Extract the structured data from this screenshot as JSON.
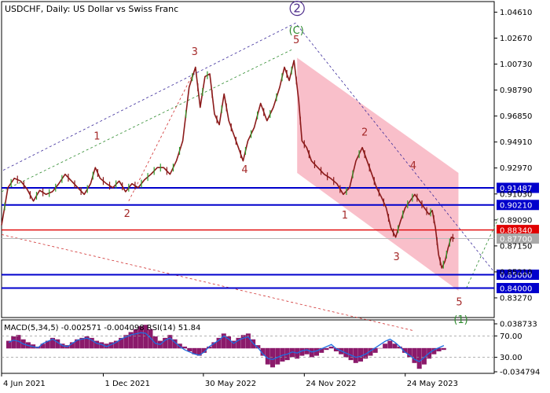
{
  "chart_data": {
    "type": "line",
    "symbol": "USDCHF, Daily:  US Dollar vs Swiss Franc",
    "y_ticks": [
      "1.04610",
      "1.02670",
      "1.00730",
      "0.98790",
      "0.96850",
      "0.94910",
      "0.92970",
      "0.91030",
      "0.89090",
      "0.87150",
      "0.85210",
      "0.83270"
    ],
    "ylim": [
      0.818,
      1.054
    ],
    "x_ticks": [
      {
        "label": "4 Jun 2021",
        "x": 0
      },
      {
        "label": "1 Dec 2021",
        "x": 128
      },
      {
        "label": "30 May 2022",
        "x": 254
      },
      {
        "label": "24 Nov 2022",
        "x": 381
      },
      {
        "label": "24 May 2023",
        "x": 508
      }
    ],
    "xlim": [
      0,
      620
    ],
    "price_path": [
      [
        0,
        0.887
      ],
      [
        8,
        0.915
      ],
      [
        16,
        0.922
      ],
      [
        24,
        0.92
      ],
      [
        32,
        0.914
      ],
      [
        40,
        0.905
      ],
      [
        48,
        0.913
      ],
      [
        56,
        0.91
      ],
      [
        64,
        0.912
      ],
      [
        72,
        0.918
      ],
      [
        80,
        0.925
      ],
      [
        88,
        0.92
      ],
      [
        96,
        0.915
      ],
      [
        104,
        0.91
      ],
      [
        112,
        0.918
      ],
      [
        118,
        0.93
      ],
      [
        124,
        0.922
      ],
      [
        132,
        0.918
      ],
      [
        140,
        0.915
      ],
      [
        148,
        0.92
      ],
      [
        156,
        0.912
      ],
      [
        164,
        0.918
      ],
      [
        172,
        0.915
      ],
      [
        180,
        0.921
      ],
      [
        188,
        0.925
      ],
      [
        196,
        0.93
      ],
      [
        204,
        0.93
      ],
      [
        212,
        0.925
      ],
      [
        220,
        0.935
      ],
      [
        228,
        0.95
      ],
      [
        236,
        0.99
      ],
      [
        244,
        1.005
      ],
      [
        250,
        0.975
      ],
      [
        256,
        0.998
      ],
      [
        262,
        1.0
      ],
      [
        268,
        0.97
      ],
      [
        274,
        0.962
      ],
      [
        280,
        0.985
      ],
      [
        286,
        0.965
      ],
      [
        292,
        0.955
      ],
      [
        298,
        0.945
      ],
      [
        304,
        0.935
      ],
      [
        310,
        0.95
      ],
      [
        318,
        0.96
      ],
      [
        326,
        0.978
      ],
      [
        334,
        0.965
      ],
      [
        342,
        0.975
      ],
      [
        350,
        0.99
      ],
      [
        356,
        1.005
      ],
      [
        362,
        0.995
      ],
      [
        368,
        1.01
      ],
      [
        374,
        0.98
      ],
      [
        378,
        0.95
      ],
      [
        384,
        0.945
      ],
      [
        390,
        0.935
      ],
      [
        398,
        0.93
      ],
      [
        406,
        0.925
      ],
      [
        414,
        0.922
      ],
      [
        422,
        0.918
      ],
      [
        430,
        0.91
      ],
      [
        438,
        0.915
      ],
      [
        446,
        0.935
      ],
      [
        454,
        0.945
      ],
      [
        460,
        0.935
      ],
      [
        466,
        0.925
      ],
      [
        472,
        0.915
      ],
      [
        478,
        0.908
      ],
      [
        484,
        0.9
      ],
      [
        490,
        0.885
      ],
      [
        496,
        0.878
      ],
      [
        502,
        0.89
      ],
      [
        508,
        0.9
      ],
      [
        514,
        0.905
      ],
      [
        520,
        0.91
      ],
      [
        526,
        0.905
      ],
      [
        532,
        0.9
      ],
      [
        538,
        0.895
      ],
      [
        542,
        0.898
      ],
      [
        546,
        0.885
      ],
      [
        550,
        0.865
      ],
      [
        554,
        0.855
      ],
      [
        558,
        0.86
      ],
      [
        562,
        0.87
      ],
      [
        566,
        0.878
      ],
      [
        570,
        0.877
      ]
    ],
    "levels": [
      {
        "value": 0.91487,
        "label": "0.91487",
        "kind": "blue"
      },
      {
        "value": 0.9021,
        "label": "0.90210",
        "kind": "blue"
      },
      {
        "value": 0.8834,
        "label": "0.88340",
        "kind": "red"
      },
      {
        "value": 0.877,
        "label": "0.87700",
        "kind": "gray"
      },
      {
        "value": 0.85,
        "label": "0.85000",
        "kind": "blue"
      },
      {
        "value": 0.84,
        "label": "0.84000",
        "kind": "blue"
      }
    ],
    "channel": [
      [
        372,
        1.01
      ],
      [
        575,
        0.84
      ],
      [
        575,
        0.926
      ],
      [
        372,
        0.926
      ]
    ],
    "channel_fill": [
      [
        372,
        1.012
      ],
      [
        575,
        0.926
      ],
      [
        575,
        0.838
      ],
      [
        372,
        0.926
      ]
    ],
    "wave_labels": [
      {
        "text": "1",
        "x": 120,
        "y": 0.951,
        "color": "red"
      },
      {
        "text": "2",
        "x": 158,
        "y": 0.893,
        "color": "red"
      },
      {
        "text": "3",
        "x": 243,
        "y": 1.014,
        "color": "red"
      },
      {
        "text": "4",
        "x": 306,
        "y": 0.926,
        "color": "red"
      },
      {
        "text": "5",
        "x": 371,
        "y": 1.023,
        "color": "red"
      },
      {
        "text": "2",
        "x": 457,
        "y": 0.954,
        "color": "red"
      },
      {
        "text": "1",
        "x": 432,
        "y": 0.892,
        "color": "red"
      },
      {
        "text": "4",
        "x": 518,
        "y": 0.929,
        "color": "red"
      },
      {
        "text": "3",
        "x": 497,
        "y": 0.861,
        "color": "red"
      },
      {
        "text": "5",
        "x": 576,
        "y": 0.827,
        "color": "red"
      },
      {
        "text": "(C)",
        "x": 371,
        "y": 1.03,
        "color": "green"
      },
      {
        "text": "(1)",
        "x": 578,
        "y": 0.814,
        "color": "green"
      },
      {
        "text": "2",
        "x": 372,
        "y": 1.046,
        "color": "purple"
      }
    ],
    "guides": [
      {
        "points": [
          [
            2,
            0.928
          ],
          [
            370,
            1.038
          ],
          [
            620,
            0.852
          ]
        ],
        "color": "#3a2a9a",
        "dash": "3,3"
      },
      {
        "points": [
          [
            0,
            0.912
          ],
          [
            365,
            1.018
          ]
        ],
        "color": "#2e8b2e",
        "dash": "3,3"
      },
      {
        "points": [
          [
            0,
            0.88
          ],
          [
            520,
            0.808
          ]
        ],
        "color": "#d03030",
        "dash": "3,3"
      },
      {
        "points": [
          [
            160,
            0.905
          ],
          [
            245,
            1.005
          ]
        ],
        "color": "#d03030",
        "dash": "3,3"
      },
      {
        "points": [
          [
            585,
            0.84
          ],
          [
            625,
            0.892
          ]
        ],
        "color": "#2e8b2e",
        "dash": "3,3"
      }
    ],
    "indicator": {
      "label": "MACD(5,34,5) -0.002571 -0.004098 RSI(14) 51.84",
      "ticks": [
        "0.038733",
        "70.00",
        "30.00",
        "-0.034794"
      ]
    },
    "macd_hist": [
      0.01,
      0.016,
      0.018,
      0.012,
      0.008,
      0.005,
      0.002,
      0.006,
      0.01,
      0.014,
      0.012,
      0.006,
      0.004,
      0.008,
      0.012,
      0.014,
      0.016,
      0.014,
      0.01,
      0.008,
      0.006,
      0.008,
      0.01,
      0.014,
      0.018,
      0.022,
      0.026,
      0.03,
      0.032,
      0.026,
      0.016,
      0.01,
      0.014,
      0.018,
      0.012,
      0.006,
      0.002,
      -0.004,
      -0.008,
      -0.01,
      -0.006,
      0.002,
      0.008,
      0.014,
      0.02,
      0.016,
      0.01,
      0.014,
      0.018,
      0.02,
      0.012,
      0.004,
      -0.01,
      -0.022,
      -0.026,
      -0.022,
      -0.018,
      -0.016,
      -0.012,
      -0.014,
      -0.01,
      -0.008,
      -0.012,
      -0.01,
      -0.006,
      -0.002,
      0.002,
      -0.004,
      -0.008,
      -0.012,
      -0.016,
      -0.02,
      -0.018,
      -0.014,
      -0.01,
      -0.006,
      0.0,
      0.006,
      0.01,
      0.006,
      0.002,
      -0.006,
      -0.012,
      -0.02,
      -0.028,
      -0.022,
      -0.014,
      -0.008,
      -0.004,
      -0.002
    ],
    "rsi": [
      58,
      62,
      60,
      55,
      52,
      50,
      48,
      56,
      60,
      64,
      58,
      52,
      50,
      56,
      62,
      64,
      66,
      62,
      56,
      54,
      50,
      54,
      58,
      64,
      68,
      72,
      74,
      76,
      75,
      66,
      56,
      54,
      62,
      66,
      58,
      50,
      44,
      40,
      36,
      34,
      40,
      50,
      56,
      62,
      70,
      64,
      56,
      62,
      66,
      68,
      56,
      48,
      36,
      28,
      26,
      30,
      34,
      36,
      40,
      38,
      42,
      44,
      40,
      42,
      46,
      50,
      54,
      46,
      42,
      38,
      34,
      30,
      32,
      36,
      42,
      48,
      54,
      60,
      64,
      58,
      50,
      40,
      34,
      26,
      22,
      30,
      38,
      44,
      48,
      52
    ]
  }
}
